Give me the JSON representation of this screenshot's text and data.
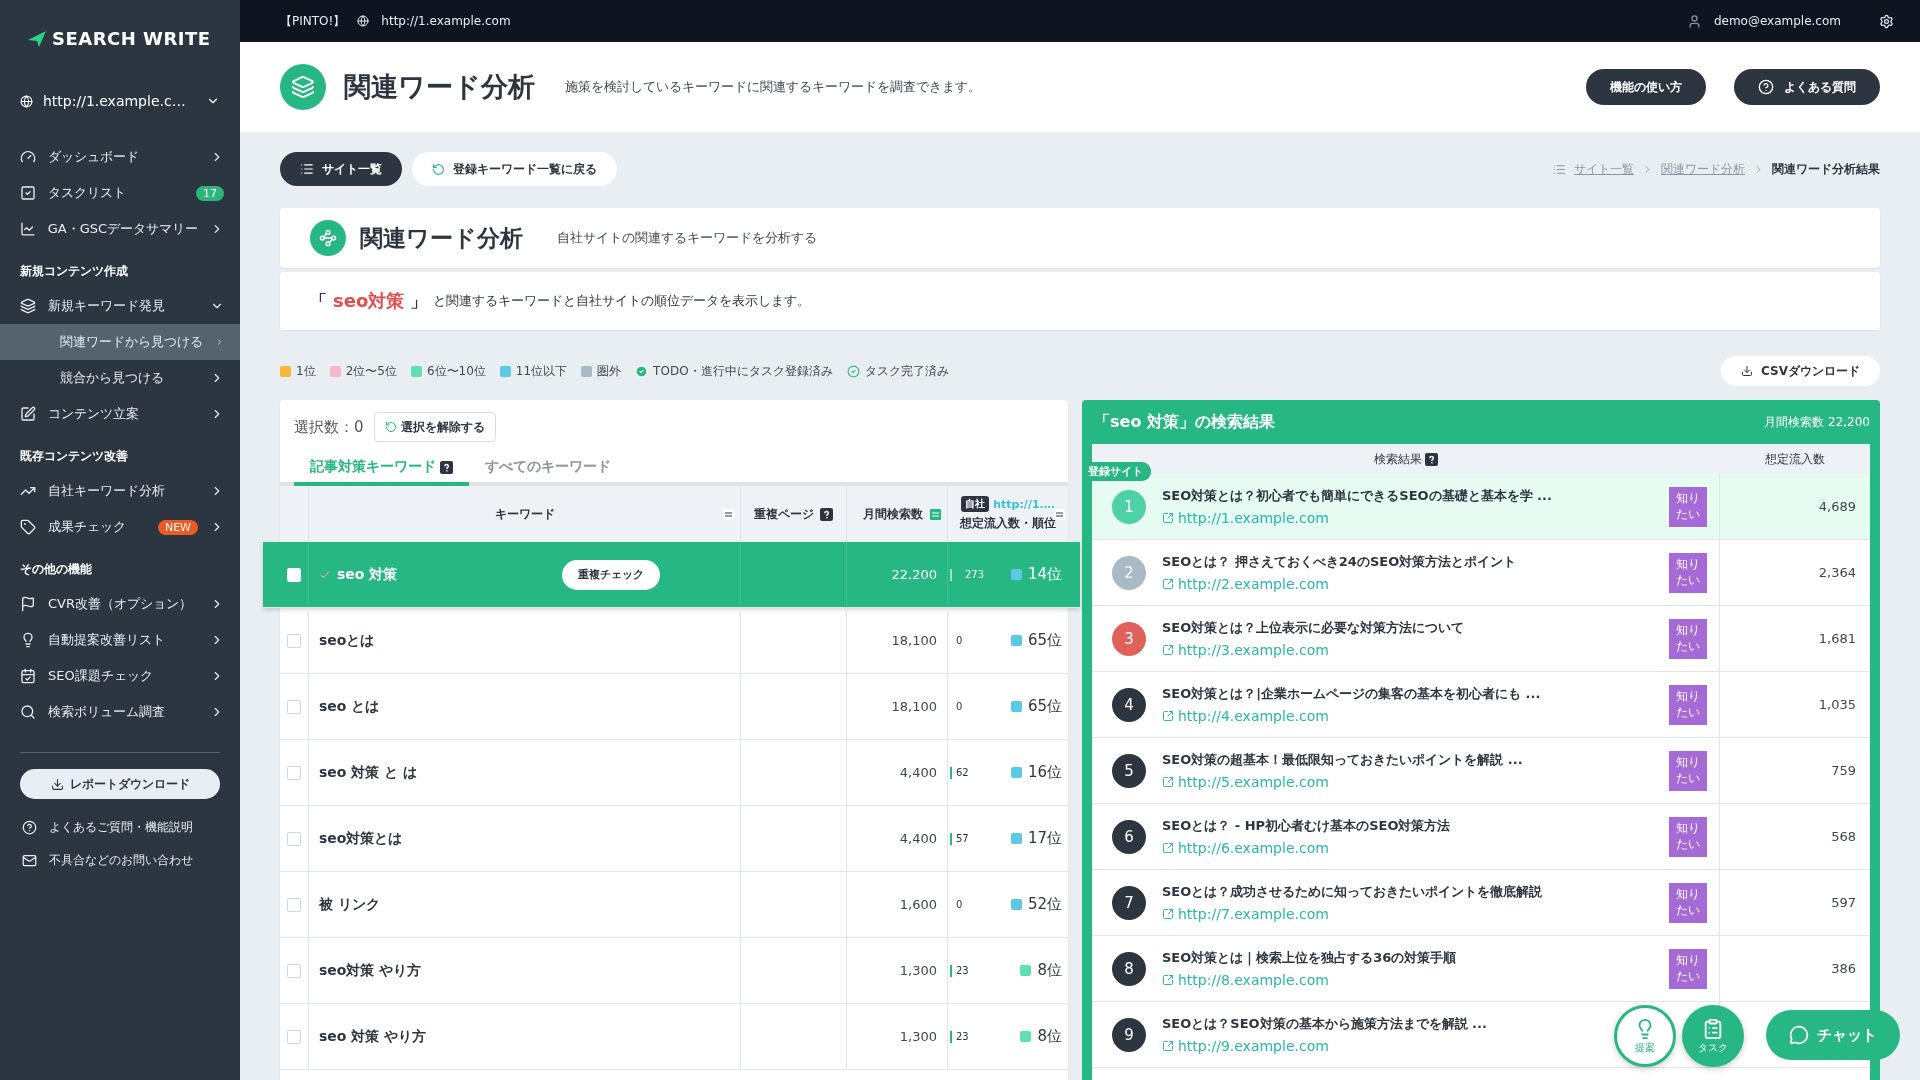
{
  "top_bar": {
    "project": "【PINTO!】",
    "site": "http://1.example.com",
    "user": "demo@example.com"
  },
  "sidebar": {
    "logo": "SEARCH WRITE",
    "site_select": "http://1.example.c…",
    "sections": [
      {
        "items": [
          {
            "label": "ダッシュボード",
            "selected": false,
            "expanded": false
          },
          {
            "label": "タスクリスト",
            "selected": false,
            "badge": {
              "text": "17",
              "color": "#2bb67a"
            }
          },
          {
            "label": "GA・GSCデータサマリー",
            "selected": false,
            "expanded": false
          }
        ]
      },
      {
        "heading": "新規コンテンツ作成",
        "items": [
          {
            "label": "新規キーワード発見",
            "selected": false,
            "expanded": true,
            "children": [
              {
                "label": "関連ワードから見つける",
                "selected": true,
                "expanded": false
              },
              {
                "label": "競合から見つける",
                "selected": false,
                "expanded": false
              }
            ]
          },
          {
            "label": "コンテンツ立案",
            "selected": false,
            "expanded": false
          }
        ]
      },
      {
        "heading": "既存コンテンツ改善",
        "items": [
          {
            "label": "自社キーワード分析",
            "selected": false,
            "expanded": false
          },
          {
            "label": "成果チェック",
            "selected": false,
            "expanded": false,
            "badge": {
              "text": "NEW",
              "color": "#ee5a24"
            }
          }
        ]
      },
      {
        "heading": "その他の機能",
        "items": [
          {
            "label": "CVR改善（オプション）",
            "selected": false,
            "expanded": false
          },
          {
            "label": "自動提案改善リスト",
            "selected": false,
            "expanded": false
          },
          {
            "label": "SEO課題チェック",
            "selected": false,
            "expanded": false
          },
          {
            "label": "検索ボリューム調査",
            "selected": false,
            "expanded": false
          }
        ]
      }
    ],
    "download_button": "レポートダウンロード",
    "links": [
      "よくあるご質問・機能説明",
      "不具合などのお問い合わせ"
    ]
  },
  "header": {
    "title": "関連ワード分析",
    "description": "施策を検討しているキーワードに関連するキーワードを調査できます。",
    "buttons": [
      {
        "label": "機能の使い方",
        "kind": "plain"
      },
      {
        "label": "よくある質問",
        "kind": "help"
      }
    ]
  },
  "nav": {
    "site_list_button": "サイト一覧",
    "back_button": "登録キーワード一覧に戻る",
    "breadcrumb": [
      "サイト一覧",
      "関連ワード分析",
      "関連ワード分析結果"
    ]
  },
  "analysis": {
    "title": "関連ワード分析",
    "subtitle": "自社サイトの関連するキーワードを分析する",
    "open_quote": "「",
    "keyword": "seo対策",
    "close_quote": "」",
    "message": "と関連するキーワードと自社サイトの順位データを表示します。"
  },
  "legend": [
    {
      "label": "1位",
      "kind": "swatch",
      "color": "#f6b73c"
    },
    {
      "label": "2位〜5位",
      "kind": "swatch",
      "color": "#f7b6cb"
    },
    {
      "label": "6位〜10位",
      "kind": "swatch",
      "color": "#5fe0b0"
    },
    {
      "label": "11位以下",
      "kind": "swatch",
      "color": "#5bc8e6"
    },
    {
      "label": "圏外",
      "kind": "swatch",
      "color": "#a9bac6"
    },
    {
      "label": "TODO・進行中にタスク登録済み",
      "kind": "check-filled"
    },
    {
      "label": "タスク完了済み",
      "kind": "check-outline"
    }
  ],
  "csv_button": "CSVダウンロード",
  "keyword_table": {
    "selection_label": "選択数：",
    "selection_count": "0",
    "clear_button": "選択を解除する",
    "tabs": [
      {
        "label": "記事対策キーワード",
        "help": true,
        "selected": true
      },
      {
        "label": "すべてのキーワード",
        "help": false,
        "selected": false
      }
    ],
    "columns": [
      {
        "label": "キーワード"
      },
      {
        "label": "重複ページ"
      },
      {
        "label": "月間検索数"
      }
    ],
    "traffic_column": {
      "tag": "自社",
      "url": "http://1.…",
      "label": "想定流入数・順位"
    },
    "rows": [
      {
        "keyword": "seo 対策",
        "selected": true,
        "checked": false,
        "done": true,
        "action": "重複チェック",
        "volume": "22,200",
        "traffic": "273",
        "traffic_bar": true,
        "rank": "14位",
        "color": "#5bc8e6"
      },
      {
        "keyword": "seoとは",
        "selected": false,
        "checked": false,
        "done": false,
        "volume": "18,100",
        "traffic": "0",
        "traffic_bar": false,
        "rank": "65位",
        "color": "#5bc8e6"
      },
      {
        "keyword": "seo とは",
        "selected": false,
        "checked": false,
        "done": false,
        "volume": "18,100",
        "traffic": "0",
        "traffic_bar": false,
        "rank": "65位",
        "color": "#5bc8e6"
      },
      {
        "keyword": "seo 対策 と は",
        "selected": false,
        "checked": false,
        "done": false,
        "volume": "4,400",
        "traffic": "62",
        "traffic_bar": true,
        "rank": "16位",
        "color": "#5bc8e6"
      },
      {
        "keyword": "seo対策とは",
        "selected": false,
        "checked": false,
        "done": false,
        "volume": "4,400",
        "traffic": "57",
        "traffic_bar": true,
        "rank": "17位",
        "color": "#5bc8e6"
      },
      {
        "keyword": "被 リンク",
        "selected": false,
        "checked": false,
        "done": false,
        "volume": "1,600",
        "traffic": "0",
        "traffic_bar": false,
        "rank": "52位",
        "color": "#5bc8e6"
      },
      {
        "keyword": "seo対策 やり方",
        "selected": false,
        "checked": false,
        "done": false,
        "volume": "1,300",
        "traffic": "23",
        "traffic_bar": true,
        "rank": "8位",
        "color": "#5fe0b0"
      },
      {
        "keyword": "seo 対策 やり方",
        "selected": false,
        "checked": false,
        "done": false,
        "volume": "1,300",
        "traffic": "23",
        "traffic_bar": true,
        "rank": "8位",
        "color": "#5fe0b0"
      }
    ]
  },
  "serp": {
    "title": "「seo 対策」の検索結果",
    "volume": "月間検索数 22,200",
    "columns": [
      {
        "label": "検索結果",
        "help": true
      },
      {
        "label": "想定流入数",
        "help": false
      }
    ],
    "own_tag": "登録サイト",
    "results": [
      {
        "rank": "1",
        "color": "#4fd1a8",
        "own": true,
        "title": "SEO対策とは？初心者でも簡単にできるSEOの基礎と基本を学 ...",
        "url": "http://1.example.com",
        "intent": "知りたい",
        "traffic": "4,689"
      },
      {
        "rank": "2",
        "color": "#a9bac6",
        "own": false,
        "title": "SEOとは？ 押さえておくべき24のSEO対策方法とポイント",
        "url": "http://2.example.com",
        "intent": "知りたい",
        "traffic": "2,364"
      },
      {
        "rank": "3",
        "color": "#e0605a",
        "own": false,
        "title": "SEO対策とは？上位表示に必要な対策方法について",
        "url": "http://3.example.com",
        "intent": "知りたい",
        "traffic": "1,681"
      },
      {
        "rank": "4",
        "color": "#2d3640",
        "own": false,
        "title": "SEO対策とは？|企業ホームページの集客の基本を初心者にも ...",
        "url": "http://4.example.com",
        "intent": "知りたい",
        "traffic": "1,035"
      },
      {
        "rank": "5",
        "color": "#2d3640",
        "own": false,
        "title": "SEO対策の超基本！最低限知っておきたいポイントを解説 ...",
        "url": "http://5.example.com",
        "intent": "知りたい",
        "traffic": "759"
      },
      {
        "rank": "6",
        "color": "#2d3640",
        "own": false,
        "title": "SEOとは？ - HP初心者むけ基本のSEO対策方法",
        "url": "http://6.example.com",
        "intent": "知りたい",
        "traffic": "568"
      },
      {
        "rank": "7",
        "color": "#2d3640",
        "own": false,
        "title": "SEOとは？成功させるために知っておきたいポイントを徹底解説",
        "url": "http://7.example.com",
        "intent": "知りたい",
        "traffic": "597"
      },
      {
        "rank": "8",
        "color": "#2d3640",
        "own": false,
        "title": "SEO対策とは｜検索上位を独占する36の対策手順",
        "url": "http://8.example.com",
        "intent": "知りたい",
        "traffic": "386"
      },
      {
        "rank": "9",
        "color": "#2d3640",
        "own": false,
        "title": "SEOとは？SEO対策の基本から施策方法までを解説 ...",
        "url": "http://9.example.com"
      }
    ]
  },
  "floating": {
    "suggest": "提案",
    "task": "タスク",
    "chat": "チャット"
  }
}
